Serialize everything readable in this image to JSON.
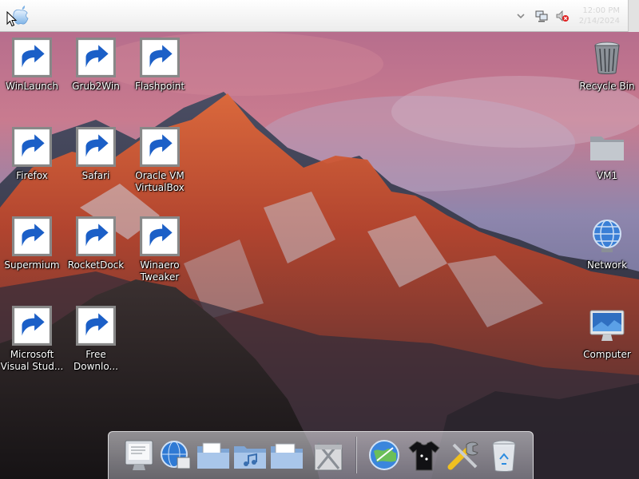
{
  "menubar": {
    "clock_time": "12:00 PM",
    "clock_date": "2/14/2024"
  },
  "desktop_icons": [
    {
      "name": "desktop-icon-winlaunch",
      "label": "WinLaunch",
      "icon": "winlaunch-icon",
      "shortcut": true
    },
    {
      "name": "desktop-icon-grub2win",
      "label": "Grub2Win",
      "icon": "grub2win-icon",
      "shortcut": true
    },
    {
      "name": "desktop-icon-flashpoint",
      "label": "Flashpoint",
      "icon": "flashpoint-icon",
      "shortcut": true
    },
    {
      "name": "desktop-icon-recycle-bin",
      "label": "Recycle Bin",
      "icon": "recycle-bin-icon",
      "shortcut": false
    },
    {
      "name": "desktop-icon-firefox",
      "label": "Firefox",
      "icon": "firefox-icon",
      "shortcut": true
    },
    {
      "name": "desktop-icon-safari",
      "label": "Safari",
      "icon": "safari-icon",
      "shortcut": true
    },
    {
      "name": "desktop-icon-virtualbox",
      "label": "Oracle VM\nVirtualBox",
      "icon": "virtualbox-icon",
      "shortcut": true
    },
    {
      "name": "desktop-icon-vm1",
      "label": "VM1",
      "icon": "folder-icon",
      "shortcut": false
    },
    {
      "name": "desktop-icon-supermium",
      "label": "Supermium",
      "icon": "supermium-icon",
      "shortcut": true
    },
    {
      "name": "desktop-icon-rocketdock",
      "label": "RocketDock",
      "icon": "rocketdock-icon",
      "shortcut": true
    },
    {
      "name": "desktop-icon-winaero-tweaker",
      "label": "Winaero\nTweaker",
      "icon": "winaero-tweaker-icon",
      "shortcut": true
    },
    {
      "name": "desktop-icon-network",
      "label": "Network",
      "icon": "network-icon",
      "shortcut": false
    },
    {
      "name": "desktop-icon-visual-studio",
      "label": "Microsoft\nVisual Stud...",
      "icon": "visual-studio-icon",
      "shortcut": true
    },
    {
      "name": "desktop-icon-free-download",
      "label": "Free\nDownlo...",
      "icon": "free-download-manager-icon",
      "shortcut": true
    },
    {
      "name": "desktop-icon-computer",
      "label": "Computer",
      "icon": "computer-monitor-icon",
      "shortcut": false
    }
  ],
  "dock_items": [
    {
      "name": "dock-item-finder",
      "icon": "finder-icon"
    },
    {
      "name": "dock-item-network-browser",
      "icon": "globe-icon"
    },
    {
      "name": "dock-item-documents",
      "icon": "documents-folder-icon"
    },
    {
      "name": "dock-item-music",
      "icon": "music-folder-icon"
    },
    {
      "name": "dock-item-pictures",
      "icon": "pictures-folder-icon"
    },
    {
      "name": "dock-item-applications",
      "icon": "applications-icon"
    },
    {
      "name": "dock-item-internet",
      "icon": "internet-globe-icon"
    },
    {
      "name": "dock-item-clothing",
      "icon": "tshirt-icon"
    },
    {
      "name": "dock-item-utilities",
      "icon": "tools-icon"
    },
    {
      "name": "dock-item-trash",
      "icon": "trash-icon"
    }
  ]
}
